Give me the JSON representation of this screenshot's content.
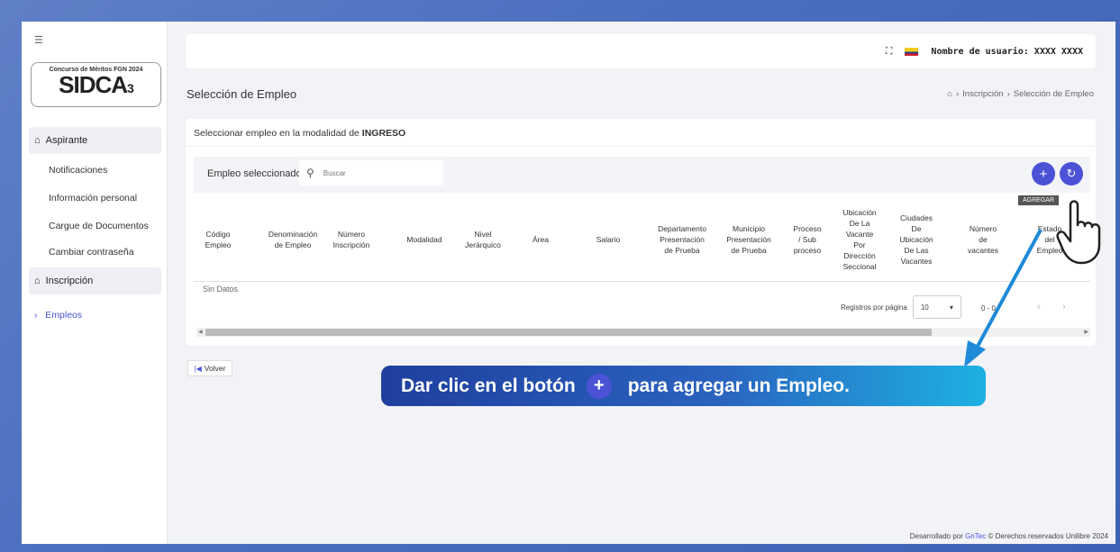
{
  "sidebar": {
    "menu_icon": "hamburger-icon",
    "logo": {
      "top_text": "Concurso de Méritos FGN 2024",
      "main_text": "SIDCA",
      "main_suffix": "3"
    },
    "sections": [
      {
        "label": "Aspirante",
        "icon": "home-icon"
      },
      {
        "label": "Inscripción",
        "icon": "home-icon"
      }
    ],
    "aspirante_items": [
      "Notificaciones",
      "Información personal",
      "Cargue de Documentos",
      "Cambiar contraseña"
    ],
    "inscripcion_items": [
      "Empleos"
    ]
  },
  "header": {
    "fullscreen_icon": "expand-icon",
    "user_label": "Nombre de usuario: XXXX XXXX"
  },
  "page": {
    "title": "Selección de Empleo",
    "breadcrumb": [
      "Inscripción",
      "Selección de Empleo"
    ]
  },
  "card": {
    "title_prefix": "Seleccionar empleo en la modalidad de ",
    "title_bold": "INGRESO",
    "toolbar_label": "Empleo seleccionado",
    "search_placeholder": "Buscar",
    "add_tooltip": "AGREGAR",
    "columns": [
      "Código\nEmpleo",
      "Denominación\nde Empleo",
      "Número\nInscripción",
      "Modalidad",
      "Nivel\nJerárquico",
      "Área",
      "Salario",
      "Departamento\nPresentación\nde Prueba",
      "Municipio\nPresentación\nde Prueba",
      "Proceso\n/ Sub\nproceso",
      "Ubicación\nDe La\nVacante\nPor\nDirección\nSeccional",
      "Ciudades\nDe\nUbicación\nDe Las\nVacantes",
      "Número\nde\nvacantes",
      "Estado\ndel\nEmpleo"
    ],
    "empty_text": "Sin Datos",
    "pager_label": "Registros por página",
    "page_size": "10",
    "range_text": "0 - 0"
  },
  "back_label": "Volver",
  "footer": {
    "prefix": "Desarrollado por ",
    "brand": "GnTec",
    "suffix": " © Derechos reservados Unilibre 2024"
  },
  "callout": {
    "before": "Dar clic en el botón",
    "after": "para agregar un Empleo."
  },
  "colors": {
    "accent": "#4b52d6",
    "callout_start": "#1f3f9e",
    "callout_end": "#1eb1e2",
    "background": "#4a6fc0"
  }
}
